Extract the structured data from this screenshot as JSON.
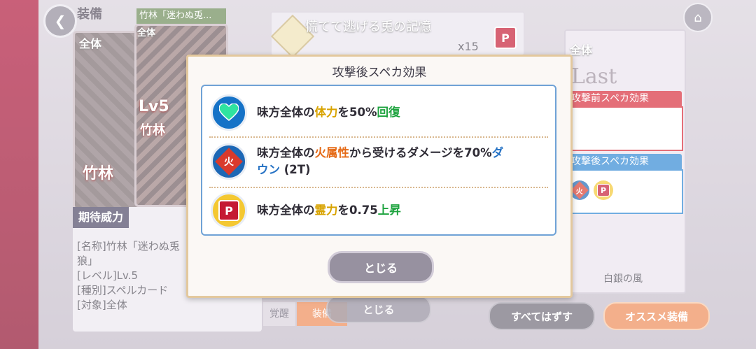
{
  "header": {
    "title": "装備",
    "back_icon": "back-arrow-icon",
    "home_icon": "home-icon"
  },
  "background": {
    "card_left_tag": "全体",
    "card_sub_title": "竹林「迷わぬ兎...",
    "card_sub_tag": "全体",
    "card_level": "Lv5",
    "card_name_art": "竹林",
    "card_name_art2": "竹林",
    "memory": {
      "title": "慌てて逃げる兎の記憶",
      "count": "x15",
      "icon": "P"
    },
    "expected_power": {
      "label": "期待威力",
      "lines": [
        "[名称]竹林「迷わぬ兎",
        "狼」",
        "[レベル]Lv.5",
        "[種別]スペルカード",
        "[対象]全体"
      ]
    },
    "right_card": {
      "tag": "全体",
      "art_text": "Last",
      "pre_label": "攻撃前スペカ効果",
      "post_label": "攻撃後スペカ効果",
      "name": "白銀の風",
      "post_icons": [
        "火",
        "P"
      ]
    },
    "buttons": {
      "awaken": "覚醒",
      "equip": "装備",
      "close_behind": "とじる",
      "remove_all": "すべてはずす",
      "recommend": "オススメ装備"
    }
  },
  "dialog": {
    "title": "攻撃後スペカ効果",
    "effects": [
      {
        "icon": "heart-heal-icon",
        "parts": [
          "味方全体の",
          "体力",
          "を50%",
          "回復"
        ]
      },
      {
        "icon": "fire-element-icon",
        "icon_text": "火",
        "parts": [
          "味方全体の",
          "火属性",
          "から受けるダメージを70%",
          "ダ",
          "ウン",
          " (2T)"
        ]
      },
      {
        "icon": "p-power-icon",
        "icon_text": "P",
        "parts": [
          "味方全体の",
          "霊力",
          "を0.75",
          "上昇"
        ]
      }
    ],
    "close_label": "とじる"
  }
}
